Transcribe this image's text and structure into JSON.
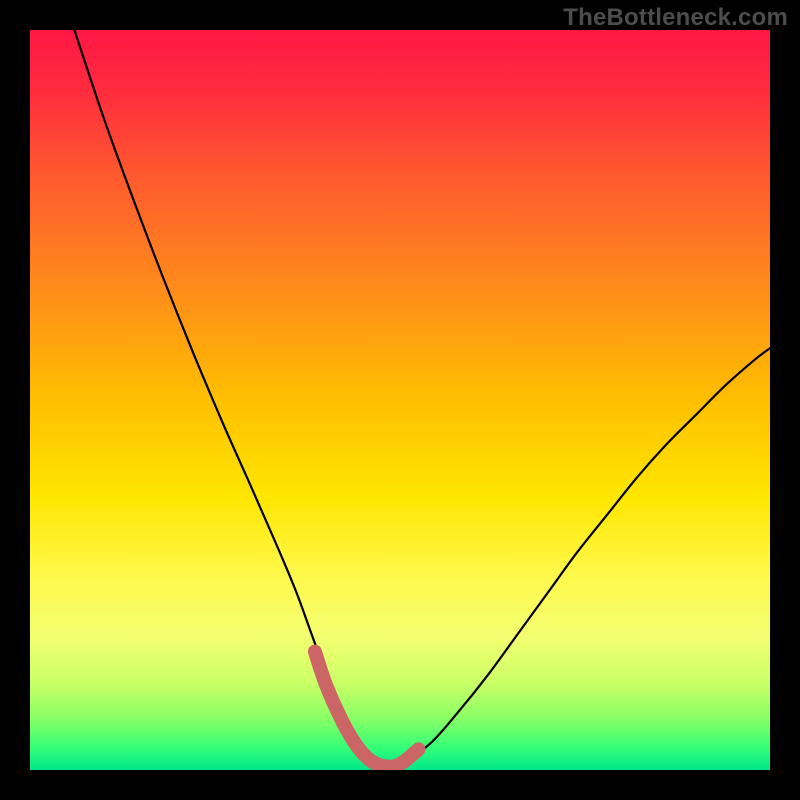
{
  "watermark": "TheBottleneck.com",
  "chart_data": {
    "type": "line",
    "title": "",
    "xlabel": "",
    "ylabel": "",
    "xlim": [
      0,
      100
    ],
    "ylim": [
      0,
      100
    ],
    "grid": false,
    "background": "vertical-gradient red->yellow->green",
    "series": [
      {
        "name": "main-curve",
        "color": "#000000",
        "x": [
          6,
          10,
          14,
          18,
          22,
          26,
          30,
          33.5,
          36,
          38,
          40,
          42,
          44,
          46,
          48,
          50,
          54,
          58,
          62,
          66,
          70,
          74,
          78,
          82,
          86,
          90,
          94,
          98,
          100
        ],
        "y": [
          100,
          88,
          77,
          66.5,
          56.5,
          47,
          38,
          30,
          24,
          18.5,
          13,
          8,
          4,
          1.5,
          0.5,
          0.8,
          3.5,
          8,
          13,
          18.5,
          24,
          29.5,
          34.5,
          39.5,
          44,
          48,
          52,
          55.5,
          57
        ]
      },
      {
        "name": "highlight-segment",
        "color": "#cc6666",
        "thick": true,
        "x": [
          38.5,
          40,
          42,
          44,
          46,
          48,
          50,
          52.5
        ],
        "y": [
          16,
          11.5,
          7,
          3.5,
          1.3,
          0.5,
          0.8,
          2.8
        ]
      }
    ],
    "gradient_stops": [
      {
        "offset": 0.0,
        "color": "#ff1744"
      },
      {
        "offset": 0.08,
        "color": "#ff2b3f"
      },
      {
        "offset": 0.2,
        "color": "#ff5a2e"
      },
      {
        "offset": 0.35,
        "color": "#ff8c1a"
      },
      {
        "offset": 0.5,
        "color": "#ffbf00"
      },
      {
        "offset": 0.63,
        "color": "#ffe600"
      },
      {
        "offset": 0.74,
        "color": "#fff94d"
      },
      {
        "offset": 0.82,
        "color": "#f3ff70"
      },
      {
        "offset": 0.88,
        "color": "#ccff66"
      },
      {
        "offset": 0.93,
        "color": "#8aff66"
      },
      {
        "offset": 0.97,
        "color": "#33ff77"
      },
      {
        "offset": 1.0,
        "color": "#00e68a"
      }
    ]
  }
}
